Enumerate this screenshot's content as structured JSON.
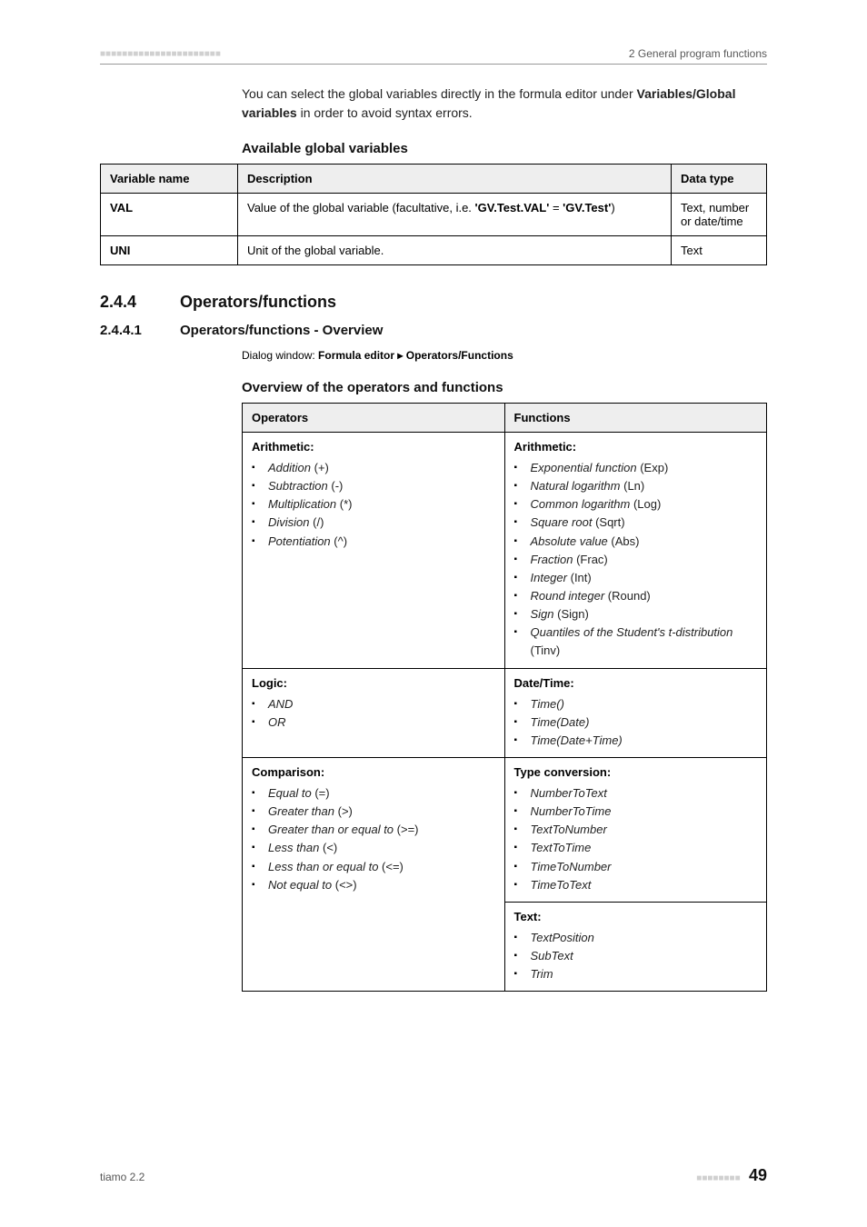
{
  "header": {
    "blocks": "■■■■■■■■■■■■■■■■■■■■■■",
    "right": "2 General program functions"
  },
  "intro": {
    "line1_a": "You can select the global variables directly in the formula editor under ",
    "line1_b": "Variables/Global variables",
    "line1_c": " in order to avoid syntax errors."
  },
  "gv": {
    "caption": "Available global variables",
    "headers": {
      "name": "Variable name",
      "desc": "Description",
      "type": "Data type"
    },
    "rows": [
      {
        "name": "VAL",
        "desc_a": "Value of the global variable (facultative, i.e. ",
        "desc_b": "'GV.Test.VAL'",
        "desc_c": " = ",
        "desc_d": "'GV.Test'",
        "desc_e": ")",
        "type": "Text, number or date/time"
      },
      {
        "name": "UNI",
        "desc": "Unit of the global variable.",
        "type": "Text"
      }
    ]
  },
  "sec": {
    "num": "2.4.4",
    "title": "Operators/functions",
    "sub_num": "2.4.4.1",
    "sub_title": "Operators/functions - Overview",
    "dialog_a": "Dialog window: ",
    "dialog_b": "Formula editor ▸ Operators/Functions",
    "caption2": "Overview of the operators and functions"
  },
  "tableHeaders": {
    "ops": "Operators",
    "funcs": "Functions"
  },
  "groups": {
    "arith": "Arithmetic:",
    "logic": "Logic:",
    "comp": "Comparison:",
    "datetime": "Date/Time:",
    "typeconv": "Type conversion:",
    "text": "Text:"
  },
  "arithOps": [
    {
      "name": "Addition",
      "sym": "(+)"
    },
    {
      "name": "Subtraction",
      "sym": "(-)"
    },
    {
      "name": "Multiplication",
      "sym": "(*)"
    },
    {
      "name": "Division",
      "sym": "(/)"
    },
    {
      "name": "Potentiation",
      "sym": "(^)"
    }
  ],
  "arithFuncs": [
    {
      "name": "Exponential function",
      "sym": "(Exp)"
    },
    {
      "name": "Natural logarithm",
      "sym": "(Ln)"
    },
    {
      "name": "Common logarithm",
      "sym": "(Log)"
    },
    {
      "name": "Square root",
      "sym": "(Sqrt)"
    },
    {
      "name": "Absolute value",
      "sym": "(Abs)"
    },
    {
      "name": "Fraction",
      "sym": "(Frac)"
    },
    {
      "name": "Integer",
      "sym": "(Int)"
    },
    {
      "name": "Round integer",
      "sym": "(Round)"
    },
    {
      "name": "Sign",
      "sym": "(Sign)"
    },
    {
      "name": "Quantiles of the Student's t-distribution",
      "sym": "(Tinv)"
    }
  ],
  "logicOps": [
    {
      "name": "AND",
      "sym": ""
    },
    {
      "name": "OR",
      "sym": ""
    }
  ],
  "datetimeFuncs": [
    {
      "name": "Time()",
      "sym": ""
    },
    {
      "name": "Time(Date)",
      "sym": ""
    },
    {
      "name": "Time(Date+Time)",
      "sym": ""
    }
  ],
  "compOps": [
    {
      "name": "Equal to",
      "sym": "(=)"
    },
    {
      "name": "Greater than",
      "sym": "(>)"
    },
    {
      "name": "Greater than or equal to",
      "sym": "(>=)"
    },
    {
      "name": "Less than",
      "sym": "(<)"
    },
    {
      "name": "Less than or equal to",
      "sym": "(<=)"
    },
    {
      "name": "Not equal to",
      "sym": "(<>)"
    }
  ],
  "typeconvFuncs": [
    {
      "name": "NumberToText",
      "sym": ""
    },
    {
      "name": "NumberToTime",
      "sym": ""
    },
    {
      "name": "TextToNumber",
      "sym": ""
    },
    {
      "name": "TextToTime",
      "sym": ""
    },
    {
      "name": "TimeToNumber",
      "sym": ""
    },
    {
      "name": "TimeToText",
      "sym": ""
    }
  ],
  "textFuncs": [
    {
      "name": "TextPosition",
      "sym": ""
    },
    {
      "name": "SubText",
      "sym": ""
    },
    {
      "name": "Trim",
      "sym": ""
    }
  ],
  "footer": {
    "left": "tiamo 2.2",
    "blocks": "■■■■■■■■",
    "page": "49"
  }
}
